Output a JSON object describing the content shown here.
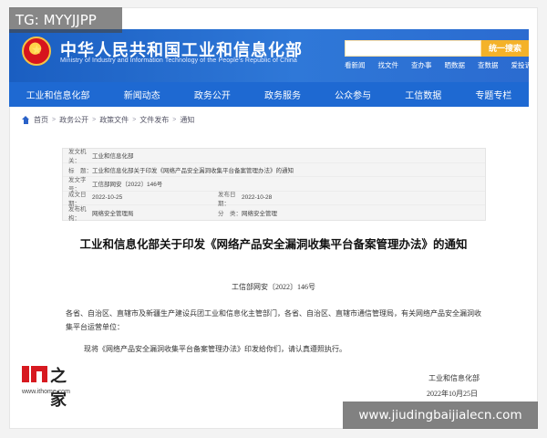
{
  "header": {
    "title": "中华人民共和国工业和信息化部",
    "subtitle": "Ministry of Industry and Information Technology of the People's Republic of China",
    "search_button": "统一搜索",
    "top_links": [
      "看新闻",
      "找文件",
      "查办事",
      "晒数据",
      "查数据",
      "爱投诉"
    ]
  },
  "nav": {
    "items": [
      "工业和信息化部",
      "新闻动态",
      "政务公开",
      "政务服务",
      "公众参与",
      "工信数据",
      "专题专栏"
    ]
  },
  "breadcrumb": [
    "首页",
    "政务公开",
    "政策文件",
    "文件发布",
    "通知"
  ],
  "meta": {
    "issuer_label": "发文机关：",
    "issuer": "工业和信息化部",
    "title_label": "标　题：",
    "title": "工业和信息化部关于印发《网络产品安全漏洞收集平台备案管理办法》的通知",
    "docno_label": "发文字号：",
    "docno": "工信部网安〔2022〕146号",
    "created_label": "成文日期：",
    "created": "2022-10-25",
    "published_label": "发布日期：",
    "published": "2022-10-28",
    "org_label": "发布机构：",
    "org": "网络安全管理局",
    "category_label": "分　类：",
    "category": "网络安全管理"
  },
  "article": {
    "title": "工业和信息化部关于印发《网络产品安全漏洞收集平台备案管理办法》的通知",
    "doc_number": "工信部网安〔2022〕146号",
    "paragraph1": "各省、自治区、直辖市及新疆生产建设兵团工业和信息化主管部门，各省、自治区、直辖市通信管理局，有关网络产品安全漏洞收集平台运营单位：",
    "paragraph2": "现将《网络产品安全漏洞收集平台备案管理办法》印发给你们，请认真遵照执行。",
    "sign_org": "工业和信息化部",
    "sign_date": "2022年10月25日"
  },
  "overlay": {
    "tg": "TG: MYYJJPP",
    "ithome_zh": "之家",
    "ithome_url": "www.ithome.com",
    "site": "www.jiudingbaijialecn.com"
  }
}
